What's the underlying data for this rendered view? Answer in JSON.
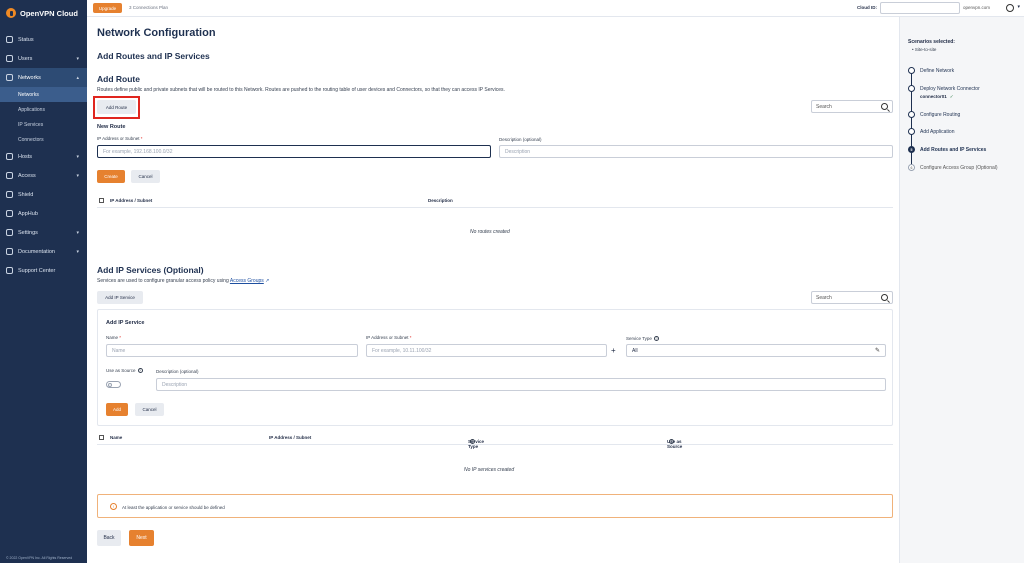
{
  "app": {
    "name": "OpenVPN Cloud",
    "copyright": "© 2022 OpenVPN Inc. All Rights Reserved"
  },
  "sidebar": {
    "items": [
      {
        "label": "Status",
        "icon": "status-icon"
      },
      {
        "label": "Users",
        "icon": "users-icon",
        "chevron": "▾"
      },
      {
        "label": "Networks",
        "icon": "networks-icon",
        "chevron": "▴",
        "active": true
      },
      {
        "label": "Hosts",
        "icon": "hosts-icon",
        "chevron": "▾"
      },
      {
        "label": "Access",
        "icon": "access-icon",
        "chevron": "▾"
      },
      {
        "label": "Shield",
        "icon": "shield-icon"
      },
      {
        "label": "AppHub",
        "icon": "apphub-icon"
      },
      {
        "label": "Settings",
        "icon": "settings-icon",
        "chevron": "▾"
      },
      {
        "label": "Documentation",
        "icon": "documentation-icon",
        "chevron": "▾"
      },
      {
        "label": "Support Center",
        "icon": "support-icon"
      }
    ],
    "subitems": [
      "Networks",
      "Applications",
      "IP Services",
      "Connectors"
    ]
  },
  "topbar": {
    "upgrade": "Upgrade",
    "plan": "3 Connections Plan",
    "cloud_id_label": "Cloud ID:",
    "cloud_domain": "openvpn.com",
    "user_chevron": "▾"
  },
  "page": {
    "title": "Network Configuration",
    "subtitle": "Add Routes and IP Services"
  },
  "add_route": {
    "title": "Add Route",
    "description": "Routes define public and private subnets that will be routed to this Network. Routes are pushed to the routing table of user devices and Connectors, so that they can access IP Services.",
    "button": "Add Route",
    "search_placeholder": "Search",
    "form_title": "New Route",
    "ip_label": "IP Address or Subnet",
    "ip_placeholder": "For example, 192.168.100.0/32",
    "desc_label": "Description (optional)",
    "desc_placeholder": "Description",
    "create": "Create",
    "cancel": "Cancel",
    "columns": [
      "IP Address / Subnet",
      "Description"
    ],
    "empty": "No routes created"
  },
  "ip_services": {
    "title": "Add IP Services (Optional)",
    "description_prefix": "Services are used to configure granular access policy using",
    "link": "Access Groups",
    "link_icon": "↗",
    "button": "Add IP Service",
    "search_placeholder": "Search",
    "form_title": "Add IP Service",
    "name_label": "Name",
    "name_placeholder": "Name",
    "ip_label": "IP Address or Subnet",
    "ip_placeholder": "For example, 10.11.100/32",
    "plus": "+",
    "type_label": "Service Type",
    "type_value": "All",
    "use_source_label": "Use as Source",
    "desc_label": "Description (optional)",
    "desc_placeholder": "Description",
    "add": "Add",
    "cancel": "Cancel",
    "columns": [
      "Name",
      "IP Address / Subnet",
      "Service Type",
      "Use as Source"
    ],
    "empty": "No IP services created"
  },
  "warning": {
    "icon": "!",
    "text": "At least the application or service should be defined"
  },
  "footer": {
    "back": "Back",
    "next": "Next"
  },
  "scenarios": {
    "title": "Scenarios selected:",
    "item": "Site-to-site",
    "steps": [
      {
        "label": "Define Network",
        "state": "done"
      },
      {
        "label": "Deploy Network Connector",
        "state": "done"
      },
      {
        "label": "Configure Routing",
        "state": "done"
      },
      {
        "label": "Add Application",
        "state": "done"
      },
      {
        "label": "Add Routes and IP Services",
        "state": "current",
        "number": "5"
      },
      {
        "label": "Configure Access Group (Optional)",
        "state": "future",
        "number": "6"
      }
    ],
    "connector": "connector01",
    "check": "✓"
  },
  "colors": {
    "sidebar": "#1e3050",
    "accent": "#e6812f",
    "highlight": "#e0261f"
  }
}
